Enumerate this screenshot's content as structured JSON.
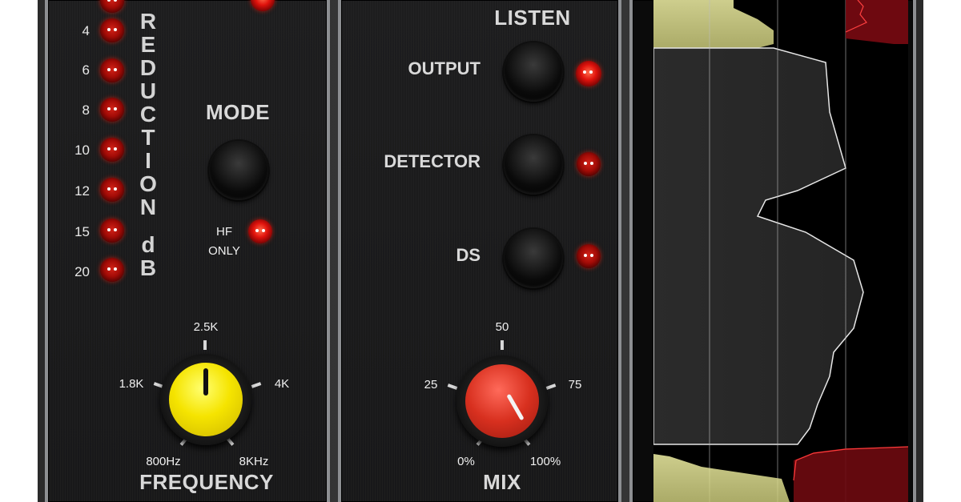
{
  "gain_reduction": {
    "scale": [
      "4",
      "6",
      "8",
      "10",
      "12",
      "15",
      "20"
    ],
    "title_letters": [
      "R",
      "E",
      "D",
      "U",
      "C",
      "T",
      "I",
      "O",
      "N"
    ],
    "unit_letters": [
      "d",
      "B"
    ]
  },
  "mode": {
    "label": "MODE",
    "hf_only_line1": "HF",
    "hf_only_line2": "ONLY"
  },
  "frequency": {
    "label": "FREQUENCY",
    "marks": {
      "top": "2.5K",
      "left": "1.8K",
      "right": "4K",
      "bottom_left": "800Hz",
      "bottom_right": "8KHz"
    },
    "knob_color": "#f5e400"
  },
  "listen": {
    "label": "LISTEN",
    "options": [
      "OUTPUT",
      "DETECTOR",
      "DS"
    ],
    "active_option": "OUTPUT"
  },
  "mix": {
    "label": "MIX",
    "marks": {
      "top": "50",
      "left": "25",
      "right": "75",
      "bottom_left": "0%",
      "bottom_right": "100%"
    },
    "knob_color": "#d8301f"
  },
  "colors": {
    "led_red": "#e0120c",
    "meter_yellow": "#e8e89a",
    "meter_red": "#a0101a"
  }
}
